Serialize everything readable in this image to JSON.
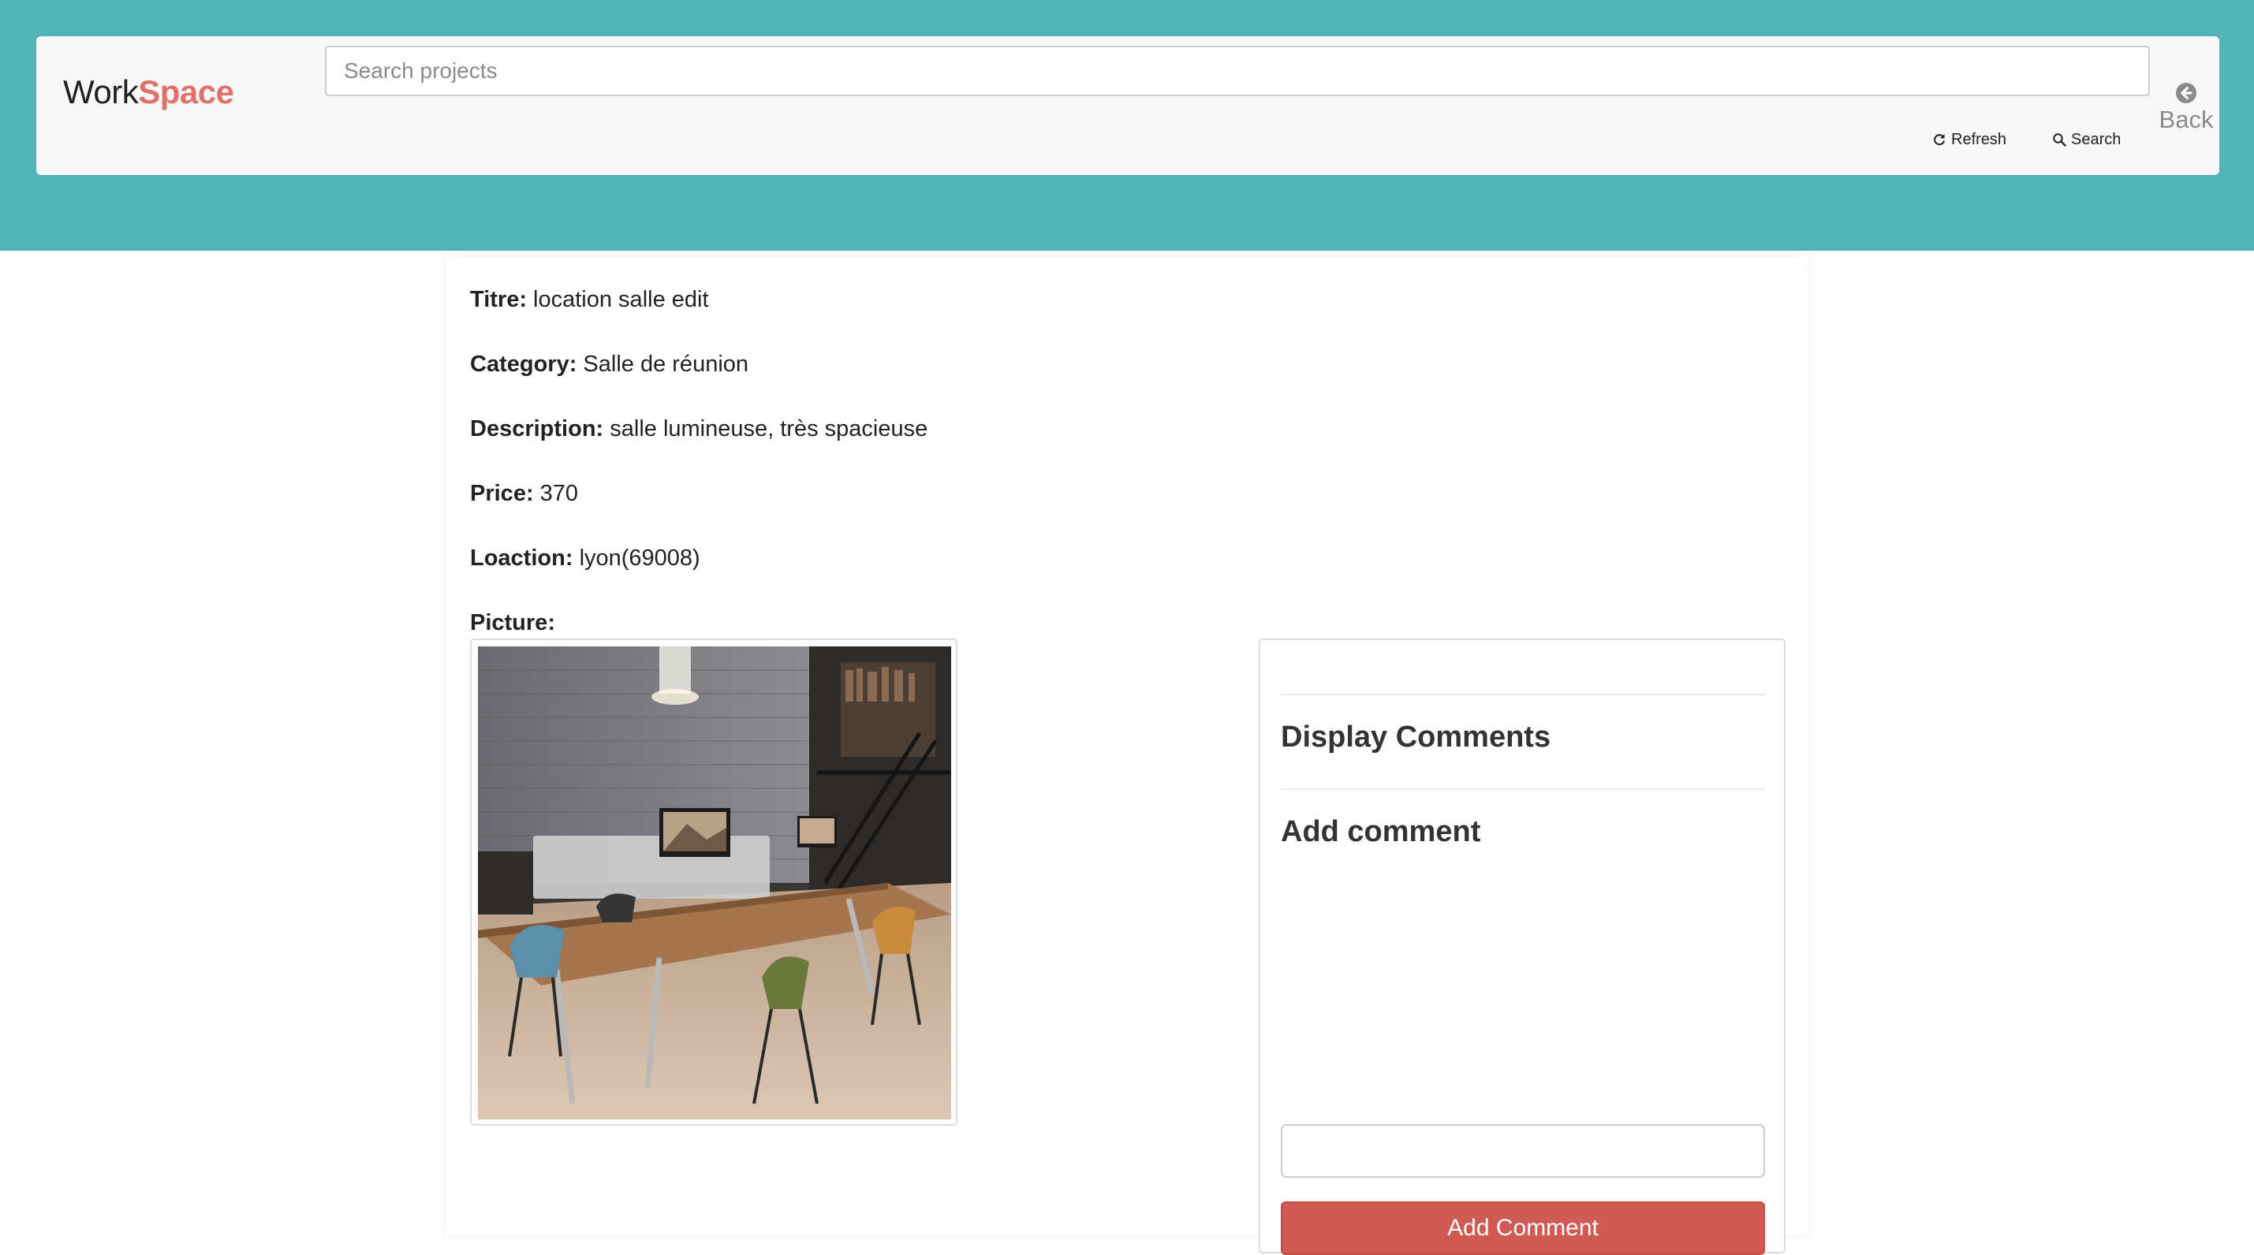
{
  "header": {
    "brand_part1": "Work",
    "brand_part2": "Space",
    "search_placeholder": "Search projects",
    "refresh_label": "Refresh",
    "search_label": "Search",
    "back_label": "Back",
    "icons": {
      "refresh": "refresh-icon",
      "search": "magnifier-icon",
      "back": "circle-arrow-left-icon"
    }
  },
  "details": {
    "title_label": "Titre:",
    "title_value": "location salle edit",
    "category_label": "Category:",
    "category_value": "Salle de réunion",
    "description_label": "Description:",
    "description_value": "salle lumineuse, très spacieuse",
    "price_label": "Price:",
    "price_value": "370",
    "location_label": "Loaction:",
    "location_value": "lyon(69008)",
    "picture_label": "Picture:"
  },
  "comments": {
    "display_heading": "Display Comments",
    "add_heading": "Add comment",
    "comment_value": "",
    "add_button_label": "Add Comment"
  },
  "colors": {
    "header_band": "#52b4b7",
    "brand_accent": "#e0706a",
    "add_button": "#d05b54"
  }
}
